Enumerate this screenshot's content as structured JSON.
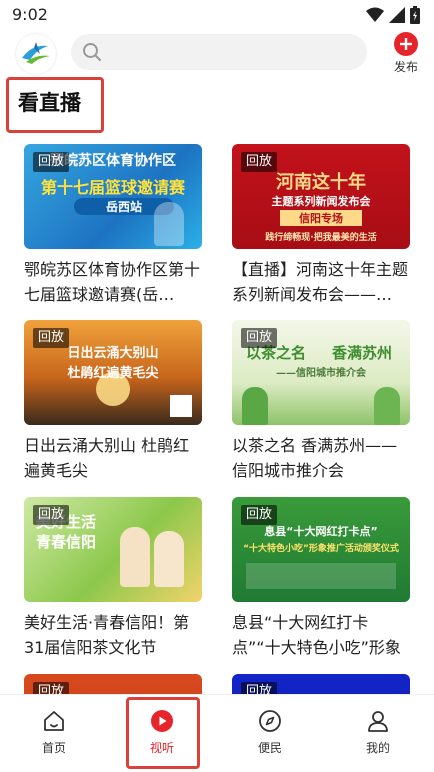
{
  "status_bar": {
    "time": "9:02",
    "icons": [
      "wifi-icon",
      "signal-icon",
      "battery-icon"
    ]
  },
  "header": {
    "search_placeholder": "",
    "publish_label": "发布"
  },
  "section": {
    "title": "看直播"
  },
  "badge_label": "回放",
  "cards": [
    {
      "title": "鄂皖苏区体育协作区第十七届篮球邀请赛(岳…",
      "thumb_lines": [
        "鄂皖苏区体育协作区",
        "第十七届篮球邀请赛",
        "岳西站"
      ]
    },
    {
      "title": "【直播】河南这十年主题系列新闻发布会——…",
      "thumb_lines": [
        "河南这十年",
        "主题系列新闻发布会",
        "信阳专场",
        "践行缔畅现·把我最美的生活"
      ]
    },
    {
      "title": "日出云涌大别山  杜鹃红遍黄毛尖",
      "thumb_lines": [
        "日出云涌大别山",
        "杜鹃红遍黄毛尖"
      ]
    },
    {
      "title": "以茶之名 香满苏州——信阳城市推介会",
      "thumb_lines": [
        "以茶之名",
        "香满苏州",
        "——信阳城市推介会"
      ]
    },
    {
      "title": "美好生活·青春信阳！第31届信阳茶文化节",
      "thumb_lines": [
        "美好生活",
        "青春信阳"
      ]
    },
    {
      "title": "息县“十大网红打卡点”“十大特色小吃”形象推…",
      "thumb_lines": [
        "息县“十大网红打卡点”",
        "“十大特色小吃”形象推广活动颁奖仪式"
      ]
    },
    {
      "title": "",
      "thumb_lines": []
    },
    {
      "title": "",
      "thumb_lines": []
    }
  ],
  "tabbar": [
    {
      "label": "首页",
      "icon": "home-icon",
      "active": false
    },
    {
      "label": "视听",
      "icon": "play-icon",
      "active": true
    },
    {
      "label": "便民",
      "icon": "compass-icon",
      "active": false
    },
    {
      "label": "我的",
      "icon": "user-icon",
      "active": false
    }
  ],
  "colors": {
    "accent": "#e5242b",
    "highlight_box": "#d9413a"
  }
}
